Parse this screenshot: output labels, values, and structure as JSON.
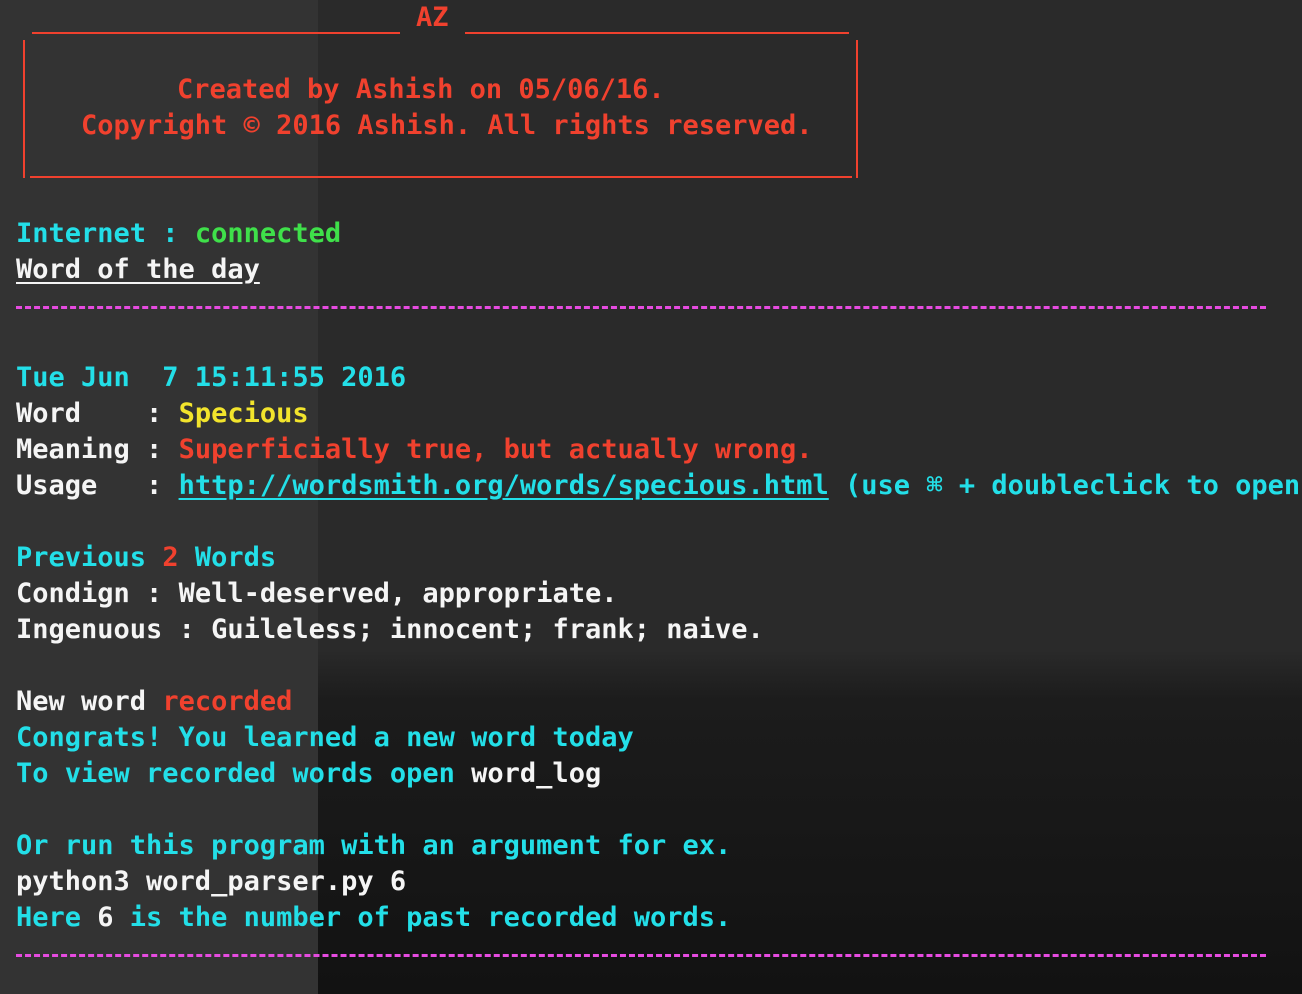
{
  "header": {
    "title": "AZ",
    "created_line": "Created by Ashish on 05/06/16.",
    "copyright_line": "Copyright © 2016 Ashish. All rights reserved."
  },
  "status": {
    "label": "Internet : ",
    "value": "connected"
  },
  "section_title": "Word of the day",
  "word_of_day": {
    "timestamp": "Tue Jun  7 15:11:55 2016",
    "word_label": "Word    : ",
    "word": "Specious",
    "meaning_label": "Meaning : ",
    "meaning": "Superficially true, but actually wrong.",
    "usage_label": "Usage   : ",
    "usage_url": "http://wordsmith.org/words/specious.html",
    "usage_hint": " (use ⌘ + doubleclick to open)"
  },
  "previous": {
    "title_pre": "Previous ",
    "count": "2",
    "title_post": " Words",
    "items": [
      {
        "word": "Condign",
        "sep": " : ",
        "meaning": "Well-deserved, appropriate."
      },
      {
        "word": "Ingenuous",
        "sep": " : ",
        "meaning": "Guileless; innocent; frank; naive."
      }
    ]
  },
  "record": {
    "new_word": "New word ",
    "recorded": "recorded",
    "congrats": "Congrats! You learned a new word today",
    "view_pre": "To view recorded words open ",
    "view_file": "word_log"
  },
  "help": {
    "line1": "Or run this program with an argument for ex.",
    "command": "python3 word_parser.py 6",
    "line3_pre": "Here ",
    "line3_num": "6",
    "line3_post": " is the number of past recorded words."
  },
  "colors": {
    "red": "#f0412e",
    "cyan": "#23dfe8",
    "green": "#3fe04a",
    "yellow": "#f2e42c",
    "magenta": "#e64be0"
  }
}
